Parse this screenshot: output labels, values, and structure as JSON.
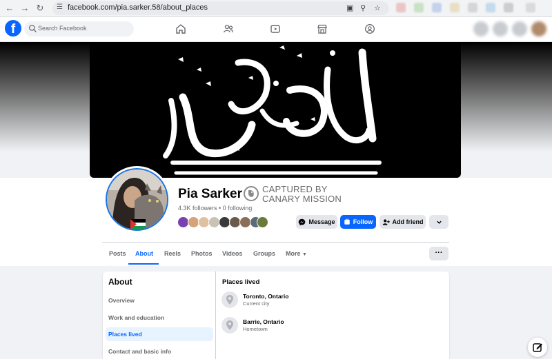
{
  "browser": {
    "url": "facebook.com/pia.sarker.58/about_places"
  },
  "header": {
    "search_placeholder": "Search Facebook",
    "nav_icons": [
      "home-icon",
      "friends-icon",
      "video-icon",
      "marketplace-icon",
      "groups-icon"
    ]
  },
  "profile": {
    "name": "Pia Sarker",
    "badge_line1": "CAPTURED BY",
    "badge_line2": "CANARY MISSION",
    "followers": "4.3K followers • 0 following",
    "buttons": {
      "message": "Message",
      "follow": "Follow",
      "add_friend": "Add friend"
    }
  },
  "tabs": [
    {
      "label": "Posts"
    },
    {
      "label": "About",
      "active": true
    },
    {
      "label": "Reels"
    },
    {
      "label": "Photos"
    },
    {
      "label": "Videos"
    },
    {
      "label": "Groups"
    },
    {
      "label": "More"
    }
  ],
  "about": {
    "title": "About",
    "items": [
      {
        "label": "Overview"
      },
      {
        "label": "Work and education"
      },
      {
        "label": "Places lived",
        "active": true
      },
      {
        "label": "Contact and basic info"
      }
    ],
    "section_title": "Places lived",
    "places": [
      {
        "name": "Toronto, Ontario",
        "sub": "Current city"
      },
      {
        "name": "Barrie, Ontario",
        "sub": "Hometown"
      }
    ]
  },
  "colors": {
    "accent": "#0866ff",
    "canary_gray": "#6a6a6a"
  }
}
